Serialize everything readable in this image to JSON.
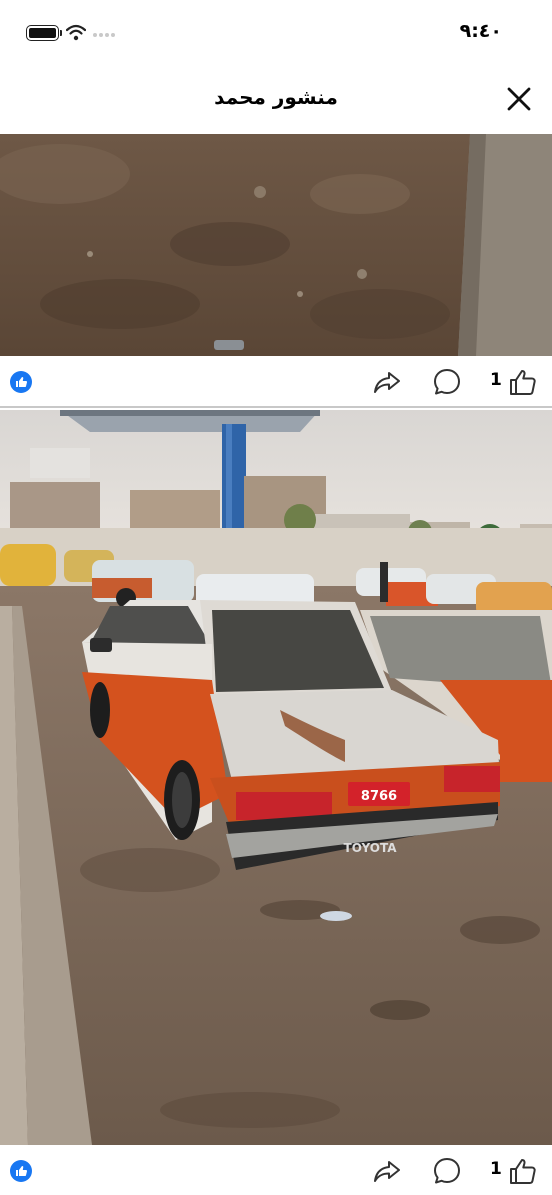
{
  "status_bar": {
    "time": "٩:٤٠",
    "icons": [
      "battery-icon",
      "wifi-icon",
      "signal-dots-icon"
    ]
  },
  "header": {
    "title": "منشور محمد",
    "close_icon": "close-icon"
  },
  "posts": [
    {
      "photo": "dirt-ground-photo",
      "reaction_icon": "like-reaction-icon",
      "like_count": "1",
      "actions": [
        "share-icon",
        "comment-icon",
        "like-icon"
      ]
    },
    {
      "photo": "old-taxi-cars-photo",
      "plate_text": "8766",
      "car_brand_text": "TOYOTA",
      "reaction_icon": "like-reaction-icon",
      "like_count": "1",
      "actions": [
        "share-icon",
        "comment-icon",
        "like-icon"
      ]
    }
  ],
  "colors": {
    "reaction_blue": "#1877f2",
    "taxi_orange": "#d8531e",
    "plate_red": "#d3222a"
  }
}
